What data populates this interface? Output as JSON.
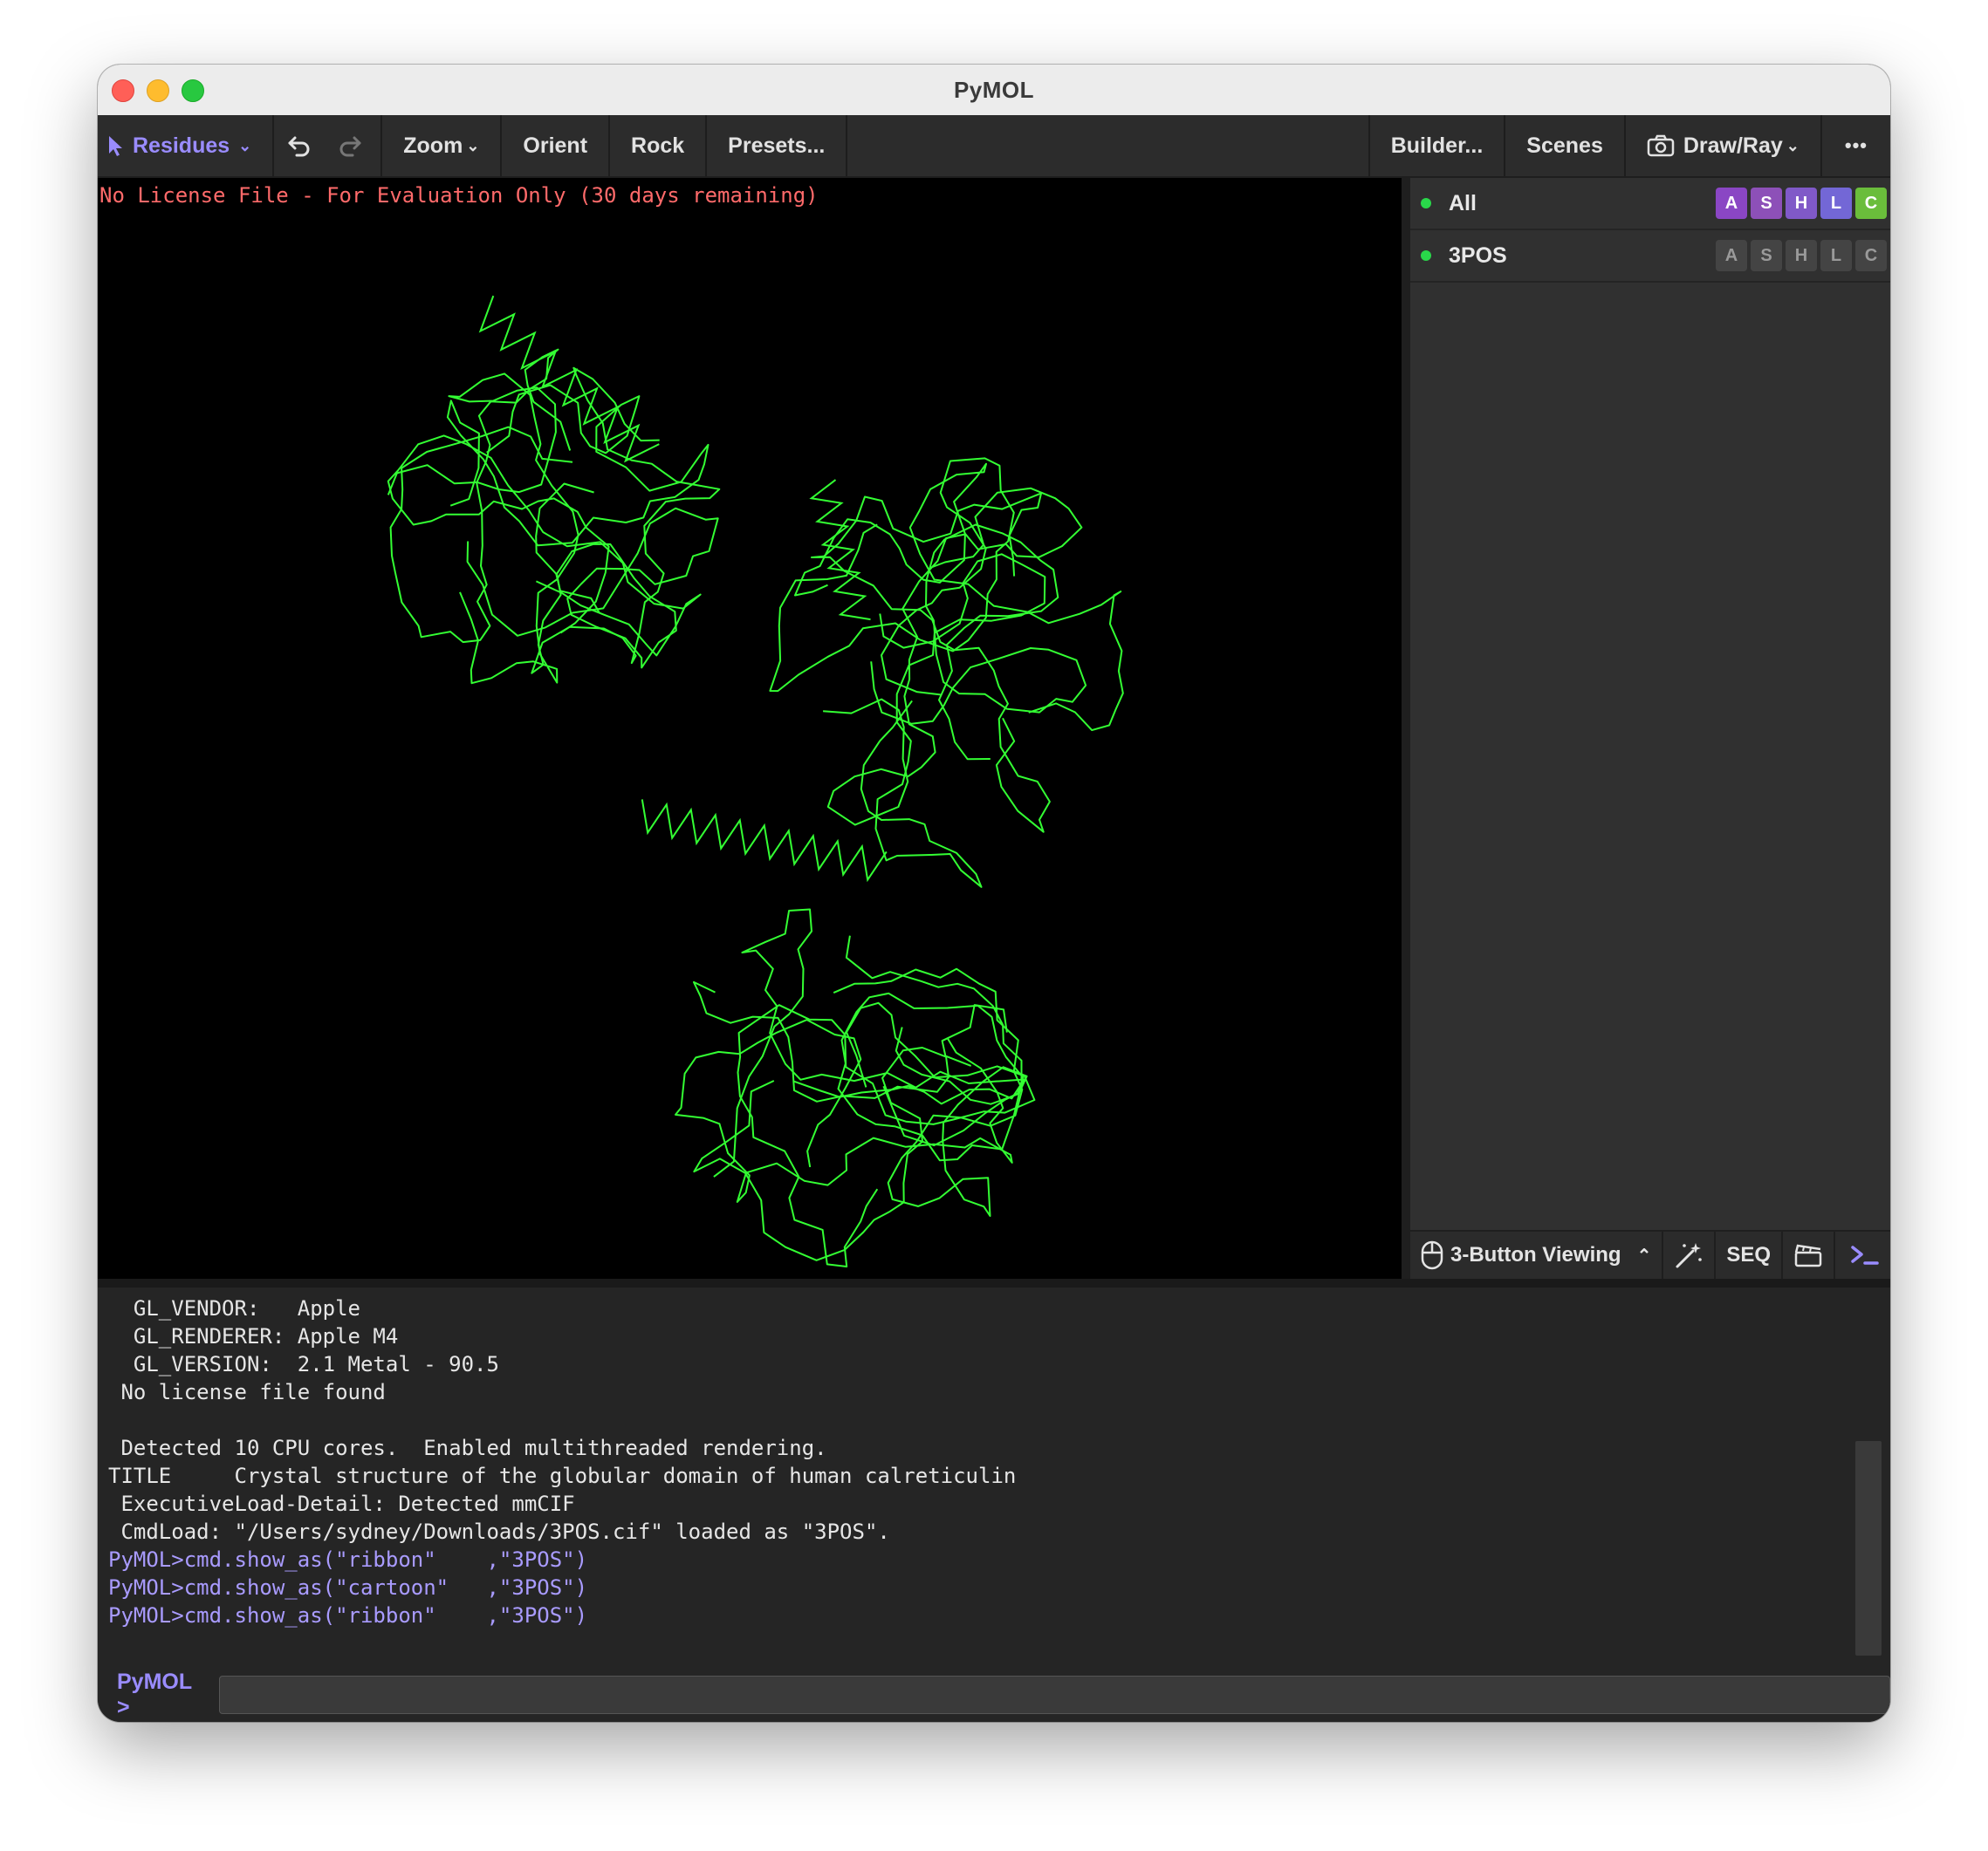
{
  "window": {
    "title": "PyMOL"
  },
  "toolbar": {
    "selection_mode": "Residues",
    "zoom": "Zoom",
    "orient": "Orient",
    "rock": "Rock",
    "presets": "Presets...",
    "builder": "Builder...",
    "scenes": "Scenes",
    "draw_ray": "Draw/Ray",
    "more": "•••",
    "undo_icon": "undo-icon",
    "redo_icon": "redo-icon",
    "camera_icon": "camera-icon"
  },
  "viewport": {
    "license_notice": "No License File - For Evaluation Only (30 days remaining)",
    "representation": "ribbon",
    "ribbon_color": "#33ff33"
  },
  "object_panel": {
    "objects": [
      {
        "name": "All",
        "buttons": [
          "A",
          "S",
          "H",
          "L",
          "C"
        ],
        "active": true
      },
      {
        "name": "3POS",
        "buttons": [
          "A",
          "S",
          "H",
          "L",
          "C"
        ],
        "active": false
      }
    ],
    "bottom": {
      "mouse_mode": "3-Button Viewing",
      "seq": "SEQ",
      "wand_icon": "magic-wand-icon",
      "movie_icon": "movie-icon",
      "terminal_icon": "terminal-icon",
      "mouse_icon": "mouse-icon"
    }
  },
  "console": {
    "lines": [
      {
        "text": "  GL_VENDOR:   Apple",
        "type": "output"
      },
      {
        "text": "  GL_RENDERER: Apple M4",
        "type": "output"
      },
      {
        "text": "  GL_VERSION:  2.1 Metal - 90.5",
        "type": "output"
      },
      {
        "text": " No license file found",
        "type": "output"
      },
      {
        "text": "",
        "type": "output"
      },
      {
        "text": " Detected 10 CPU cores.  Enabled multithreaded rendering.",
        "type": "output"
      },
      {
        "text": "TITLE     Crystal structure of the globular domain of human calreticulin",
        "type": "output"
      },
      {
        "text": " ExecutiveLoad-Detail: Detected mmCIF",
        "type": "output"
      },
      {
        "text": " CmdLoad: \"/Users/sydney/Downloads/3POS.cif\" loaded as \"3POS\".",
        "type": "output"
      },
      {
        "text": "PyMOL>cmd.show_as(\"ribbon\"    ,\"3POS\")",
        "type": "command"
      },
      {
        "text": "PyMOL>cmd.show_as(\"cartoon\"   ,\"3POS\")",
        "type": "command"
      },
      {
        "text": "PyMOL>cmd.show_as(\"ribbon\"    ,\"3POS\")",
        "type": "command"
      }
    ],
    "prompt_label": "PyMOL >",
    "input_value": ""
  }
}
